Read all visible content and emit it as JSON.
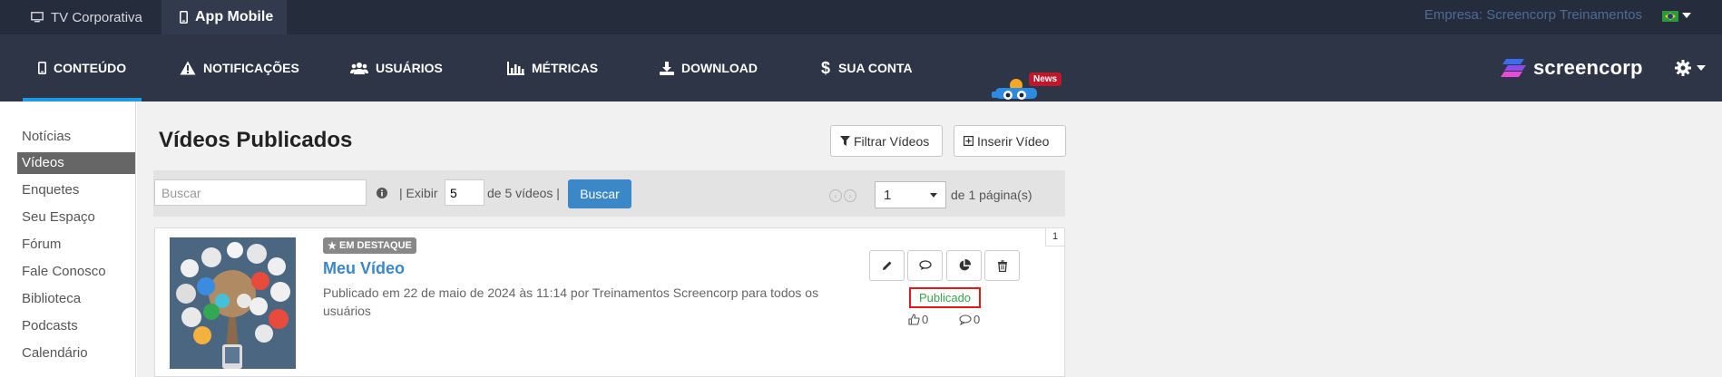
{
  "topbar": {
    "tabs": [
      {
        "label": "TV Corporativa",
        "icon": "monitor-icon"
      },
      {
        "label": "App Mobile",
        "icon": "phone-icon"
      }
    ],
    "company": "Empresa: Screencorp Treinamentos",
    "language_flag": "brazil-flag-icon"
  },
  "nav": {
    "items": [
      {
        "label": "CONTEÚDO",
        "icon": "phone-icon",
        "active": true
      },
      {
        "label": "NOTIFICAÇÕES",
        "icon": "warning-icon"
      },
      {
        "label": "USUÁRIOS",
        "icon": "users-icon"
      },
      {
        "label": "MÉTRICAS",
        "icon": "bar-chart-icon"
      },
      {
        "label": "DOWNLOAD",
        "icon": "download-icon"
      },
      {
        "label": "SUA CONTA",
        "icon": "dollar-icon"
      }
    ],
    "news_badge": "News",
    "logo": "screencorp",
    "accent": "#1a9be6"
  },
  "sidebar": {
    "items": [
      {
        "label": "Notícias"
      },
      {
        "label": "Vídeos",
        "active": true
      },
      {
        "label": "Enquetes"
      },
      {
        "label": "Seu Espaço"
      },
      {
        "label": "Fórum"
      },
      {
        "label": "Fale Conosco"
      },
      {
        "label": "Biblioteca"
      },
      {
        "label": "Podcasts"
      },
      {
        "label": "Calendário"
      }
    ]
  },
  "main": {
    "title": "Vídeos Publicados",
    "filter_button": "Filtrar Vídeos",
    "insert_button": "Inserir Vídeo",
    "search_placeholder": "Buscar",
    "exibir_label": "| Exibir",
    "exibir_value": "5",
    "count_label": "de 5 vídeos |",
    "search_button": "Buscar",
    "page_value": "1",
    "page_label": "de 1 página(s)"
  },
  "video": {
    "index": "1",
    "featured_label": "EM DESTAQUE",
    "title": "Meu Vídeo",
    "description": "Publicado em 22 de maio de 2024 às 11:14 por Treinamentos Screencorp para todos os usuários",
    "status": "Publicado",
    "likes": "0",
    "comments": "0",
    "status_color": "#3aa34a",
    "link_color": "#3b87c8"
  }
}
